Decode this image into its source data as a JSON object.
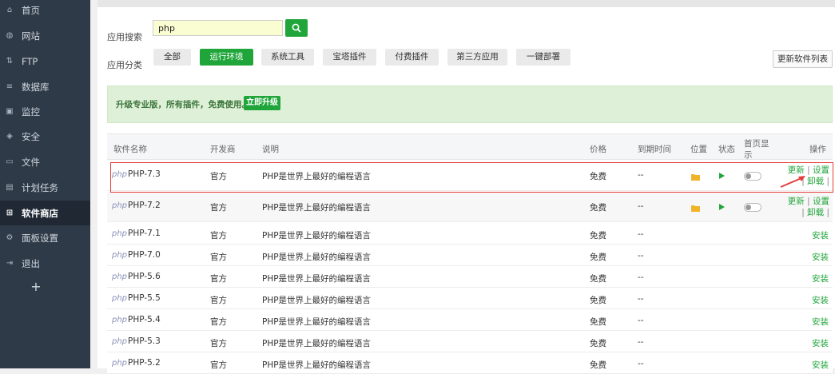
{
  "sidebar": {
    "items": [
      {
        "label": "首页",
        "icon": "home-icon"
      },
      {
        "label": "网站",
        "icon": "globe-icon"
      },
      {
        "label": "FTP",
        "icon": "ftp-icon"
      },
      {
        "label": "数据库",
        "icon": "database-icon"
      },
      {
        "label": "监控",
        "icon": "monitor-icon"
      },
      {
        "label": "安全",
        "icon": "shield-icon"
      },
      {
        "label": "文件",
        "icon": "folder-icon"
      },
      {
        "label": "计划任务",
        "icon": "calendar-icon"
      },
      {
        "label": "软件商店",
        "icon": "grid-icon",
        "active": true
      },
      {
        "label": "面板设置",
        "icon": "gear-icon"
      },
      {
        "label": "退出",
        "icon": "logout-icon"
      }
    ],
    "add_label": "+"
  },
  "search": {
    "label": "应用搜索",
    "value": "php"
  },
  "categories": {
    "label": "应用分类",
    "items": [
      "全部",
      "运行环境",
      "系统工具",
      "宝塔插件",
      "付费插件",
      "第三方应用",
      "一键部署"
    ],
    "active_index": 1
  },
  "refresh_label": "更新软件列表",
  "promo": {
    "text": "升级专业版，所有插件，免费使用。",
    "button": "立即升级"
  },
  "table": {
    "headers": {
      "name": "软件名称",
      "dev": "开发商",
      "desc": "说明",
      "price": "价格",
      "expire": "到期时间",
      "location": "位置",
      "status": "状态",
      "home_line1": "首页显",
      "home_line2": "示",
      "ops": "操作"
    },
    "rows": [
      {
        "logo": "php",
        "name": "PHP-7.3",
        "dev": "官方",
        "desc": "PHP是世界上最好的编程语言",
        "price": "免费",
        "expire": "--",
        "installed": true,
        "ops": [
          "更新",
          "设置",
          "卸载"
        ]
      },
      {
        "logo": "php",
        "name": "PHP-7.2",
        "dev": "官方",
        "desc": "PHP是世界上最好的编程语言",
        "price": "免费",
        "expire": "--",
        "installed": true,
        "ops": [
          "更新",
          "设置",
          "卸载"
        ]
      },
      {
        "logo": "php",
        "name": "PHP-7.1",
        "dev": "官方",
        "desc": "PHP是世界上最好的编程语言",
        "price": "免费",
        "expire": "--",
        "installed": false,
        "ops": [
          "安装"
        ]
      },
      {
        "logo": "php",
        "name": "PHP-7.0",
        "dev": "官方",
        "desc": "PHP是世界上最好的编程语言",
        "price": "免费",
        "expire": "--",
        "installed": false,
        "ops": [
          "安装"
        ]
      },
      {
        "logo": "php",
        "name": "PHP-5.6",
        "dev": "官方",
        "desc": "PHP是世界上最好的编程语言",
        "price": "免费",
        "expire": "--",
        "installed": false,
        "ops": [
          "安装"
        ]
      },
      {
        "logo": "php",
        "name": "PHP-5.5",
        "dev": "官方",
        "desc": "PHP是世界上最好的编程语言",
        "price": "免费",
        "expire": "--",
        "installed": false,
        "ops": [
          "安装"
        ]
      },
      {
        "logo": "php",
        "name": "PHP-5.4",
        "dev": "官方",
        "desc": "PHP是世界上最好的编程语言",
        "price": "免费",
        "expire": "--",
        "installed": false,
        "ops": [
          "安装"
        ]
      },
      {
        "logo": "php",
        "name": "PHP-5.3",
        "dev": "官方",
        "desc": "PHP是世界上最好的编程语言",
        "price": "免费",
        "expire": "--",
        "installed": false,
        "ops": [
          "安装"
        ]
      },
      {
        "logo": "php",
        "name": "PHP-5.2",
        "dev": "官方",
        "desc": "PHP是世界上最好的编程语言",
        "price": "免费",
        "expire": "--",
        "installed": false,
        "ops": [
          "安装"
        ]
      }
    ]
  },
  "colors": {
    "accent": "#20a53a",
    "sidebar": "#2f3a48",
    "highlight": "#e53b3b"
  }
}
